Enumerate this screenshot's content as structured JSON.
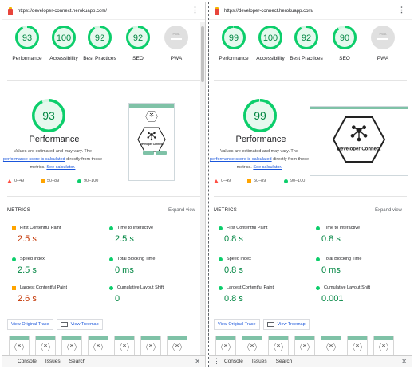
{
  "colors": {
    "pass": "#0cce6b",
    "pass_text": "#018642",
    "average": "#ffa400",
    "average_text": "#c33300",
    "fail": "#ff4e42",
    "pwa_gray": "#e0e0e0",
    "link": "#1a56db"
  },
  "reports": [
    {
      "url": "https://developer-connect.herokuapp.com/",
      "gauges": [
        {
          "score": "93",
          "value": 93,
          "label": "Performance"
        },
        {
          "score": "100",
          "value": 100,
          "label": "Accessibility"
        },
        {
          "score": "92",
          "value": 92,
          "label": "Best Practices"
        },
        {
          "score": "92",
          "value": 92,
          "label": "SEO"
        },
        {
          "score": "PWA",
          "value": 0,
          "label": "PWA"
        }
      ],
      "performance": {
        "score": "93",
        "value": 93,
        "title": "Performance",
        "desc_1": "Values are estimated and may vary. The",
        "desc_link": "performance score is calculated",
        "desc_2": "directly from these",
        "desc_3": "metrics.",
        "calc_link": "See calculator."
      },
      "legend": [
        "0–49",
        "50–89",
        "90–100"
      ],
      "metrics_title": "METRICS",
      "expand_label": "Expand view",
      "metrics": [
        {
          "name": "First Contentful Paint",
          "value": "2.5 s",
          "rating": "average"
        },
        {
          "name": "Time to Interactive",
          "value": "2.5 s",
          "rating": "pass"
        },
        {
          "name": "Speed Index",
          "value": "2.5 s",
          "rating": "pass"
        },
        {
          "name": "Total Blocking Time",
          "value": "0 ms",
          "rating": "pass"
        },
        {
          "name": "Largest Contentful Paint",
          "value": "2.6 s",
          "rating": "average"
        },
        {
          "name": "Cumulative Layout Shift",
          "value": "0",
          "rating": "pass"
        }
      ],
      "trace_label": "View Original Trace",
      "treemap_label": "View Treemap",
      "screenshot_text": "Developer Connect",
      "drawer_tabs": [
        "Console",
        "Issues",
        "Search"
      ]
    },
    {
      "url": "https://developer-connect.herokuapp.com/",
      "gauges": [
        {
          "score": "99",
          "value": 99,
          "label": "Performance"
        },
        {
          "score": "100",
          "value": 100,
          "label": "Accessibility"
        },
        {
          "score": "92",
          "value": 92,
          "label": "Best Practices"
        },
        {
          "score": "90",
          "value": 90,
          "label": "SEO"
        },
        {
          "score": "PWA",
          "value": 0,
          "label": "PWA"
        }
      ],
      "performance": {
        "score": "99",
        "value": 99,
        "title": "Performance",
        "desc_1": "Values are estimated and may vary. The",
        "desc_link": "performance score is calculated",
        "desc_2": "directly from these",
        "desc_3": "metrics.",
        "calc_link": "See calculator."
      },
      "legend": [
        "0–49",
        "50–89",
        "90–100"
      ],
      "metrics_title": "METRICS",
      "expand_label": "Expand view",
      "metrics": [
        {
          "name": "First Contentful Paint",
          "value": "0.8 s",
          "rating": "pass"
        },
        {
          "name": "Time to Interactive",
          "value": "0.8 s",
          "rating": "pass"
        },
        {
          "name": "Speed Index",
          "value": "0.8 s",
          "rating": "pass"
        },
        {
          "name": "Total Blocking Time",
          "value": "0 ms",
          "rating": "pass"
        },
        {
          "name": "Largest Contentful Paint",
          "value": "0.8 s",
          "rating": "pass"
        },
        {
          "name": "Cumulative Layout Shift",
          "value": "0.001",
          "rating": "pass"
        }
      ],
      "trace_label": "View Original Trace",
      "treemap_label": "View Treemap",
      "screenshot_text": "Developer Connect",
      "drawer_tabs": [
        "Console",
        "Issues",
        "Search"
      ]
    }
  ]
}
